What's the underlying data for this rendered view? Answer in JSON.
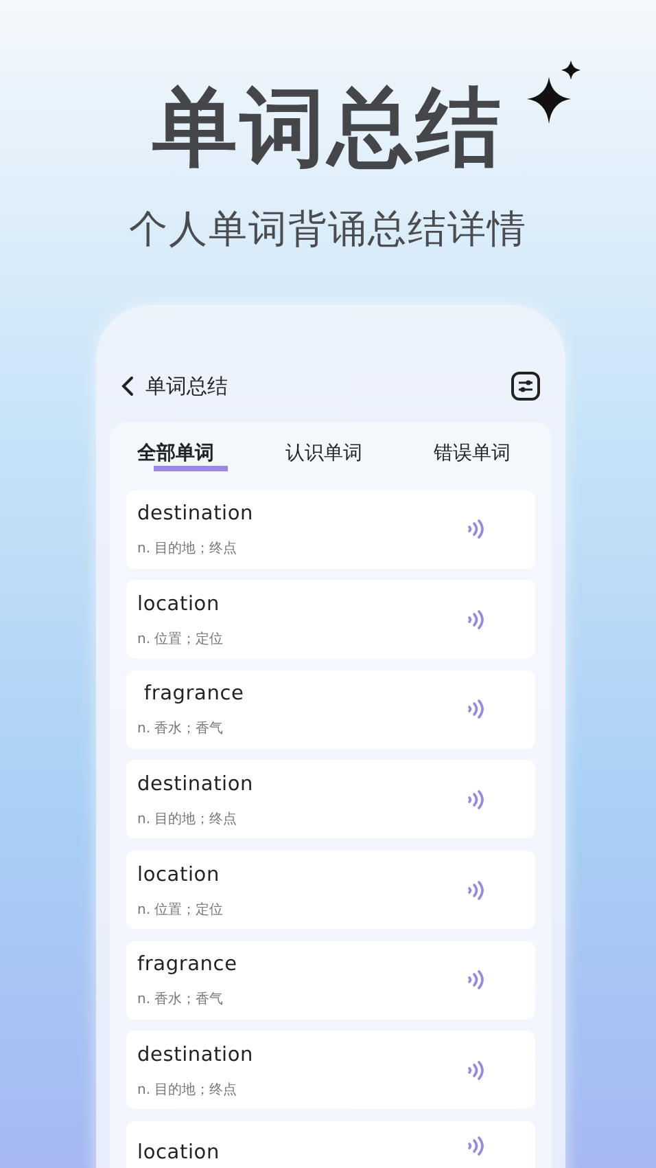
{
  "hero": {
    "title": "单词总结",
    "subtitle": "个人单词背诵总结详情"
  },
  "header": {
    "title": "单词总结"
  },
  "tabs": [
    {
      "label": "全部单词",
      "selected": true
    },
    {
      "label": "认识单词",
      "selected": false
    },
    {
      "label": "错误单词",
      "selected": false
    }
  ],
  "words": [
    {
      "word": "destination",
      "definition": "n. 目的地；终点"
    },
    {
      "word": "location",
      "definition": "n. 位置；定位"
    },
    {
      "word": " fragrance",
      "definition": "n. 香水；香气"
    },
    {
      "word": "destination",
      "definition": "n. 目的地；终点"
    },
    {
      "word": "location",
      "definition": "n. 位置；定位"
    },
    {
      "word": "fragrance",
      "definition": "n. 香水；香气"
    },
    {
      "word": "destination",
      "definition": "n. 目的地；终点"
    },
    {
      "word": "location"
    }
  ]
}
